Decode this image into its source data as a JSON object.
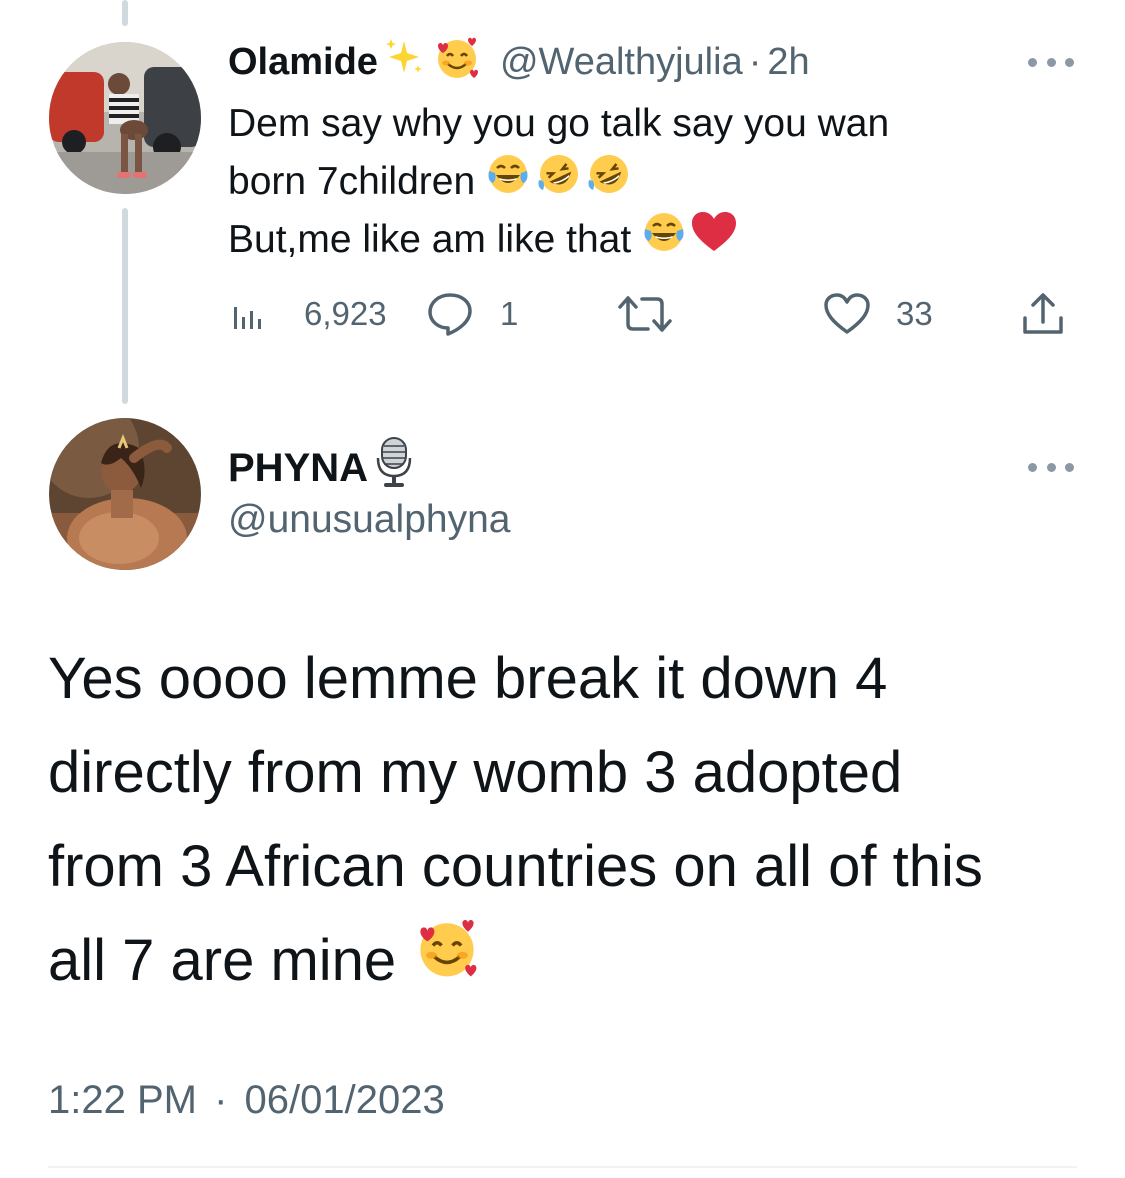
{
  "reply_tweet": {
    "author_name": "Olamide",
    "author_handle": "@Wealthyjulia",
    "separator": "·",
    "time_ago": "2h",
    "text_lines": [
      "Dem say why you go talk say you wan",
      "born 7children",
      "But,me like am like that"
    ],
    "views": "6,923",
    "replies": "1",
    "retweets": "",
    "likes": "33"
  },
  "main_tweet": {
    "author_name": "PHYNA",
    "author_handle": "@unusualphyna",
    "text_lines": [
      "Yes oooo lemme break it down 4",
      "directly from my womb 3 adopted",
      "from 3 African countries on all of this",
      "all 7 are mine"
    ],
    "time": "1:22 PM",
    "separator": "·",
    "date": "06/01/2023"
  },
  "icons": {
    "name_emoji_1": "sparkles-emoji",
    "name_emoji_2": "smiling-face-with-hearts-emoji",
    "name_emoji_3": "studio-microphone-emoji",
    "text_emojis": [
      "face-with-tears-of-joy-emoji",
      "rolling-on-floor-laughing-emoji",
      "red-heart-emoji"
    ]
  },
  "colors": {
    "text": "#0f1419",
    "secondary": "#536471",
    "thread_line": "#cfd9de"
  }
}
